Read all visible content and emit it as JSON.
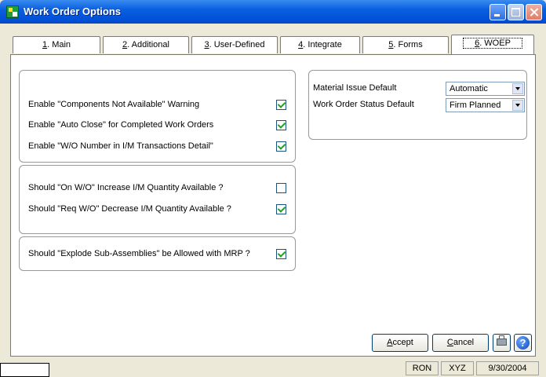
{
  "window": {
    "title": "Work Order Options"
  },
  "tabs": [
    {
      "key": "1",
      "label": ". Main"
    },
    {
      "key": "2",
      "label": ". Additional"
    },
    {
      "key": "3",
      "label": ". User-Defined"
    },
    {
      "key": "4",
      "label": ". Integrate"
    },
    {
      "key": "5",
      "label": ". Forms"
    },
    {
      "key": "6",
      "label": ". WOEP"
    }
  ],
  "group1": {
    "rows": [
      {
        "label": "Enable \"Components Not Available\" Warning",
        "checked": true
      },
      {
        "label": "Enable \"Auto Close\" for Completed Work Orders",
        "checked": true
      },
      {
        "label": "Enable \"W/O Number in I/M Transactions Detail\"",
        "checked": true
      }
    ]
  },
  "group2": {
    "rows": [
      {
        "label": "Should \"On W/O\" Increase I/M Quantity Available ?",
        "checked": false
      },
      {
        "label": "Should \"Req W/O\" Decrease I/M Quantity Available ?",
        "checked": true
      }
    ]
  },
  "group3": {
    "rows": [
      {
        "label": "Should \"Explode Sub-Assemblies\" be Allowed with MRP ?",
        "checked": true
      }
    ]
  },
  "defaults": {
    "material_issue_label": "Material Issue Default",
    "material_issue_value": "Automatic",
    "wo_status_label": "Work Order Status Default",
    "wo_status_value": "Firm Planned"
  },
  "buttons": {
    "accept_key": "A",
    "accept_rest": "ccept",
    "cancel_key": "C",
    "cancel_rest": "ancel",
    "printer_icon": "printer-icon",
    "help_icon": "help-icon"
  },
  "status": {
    "user": "RON",
    "company": "XYZ",
    "date": "9/30/2004"
  },
  "colors": {
    "titlebar": "#0a5fe0",
    "window_bg": "#ece9d8",
    "check_mark": "#21a121"
  }
}
